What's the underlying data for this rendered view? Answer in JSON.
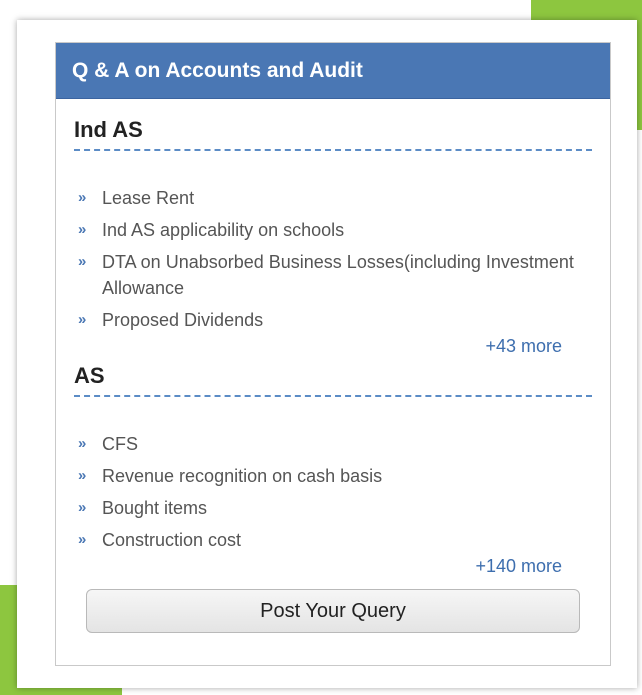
{
  "panel": {
    "title": "Q & A on Accounts and Audit",
    "button_label": "Post Your Query"
  },
  "sections": [
    {
      "heading": "Ind AS",
      "items": [
        "Lease Rent",
        "Ind AS applicability on schools",
        "DTA on Unabsorbed Business Losses(including Investment Allowance",
        "Proposed Dividends"
      ],
      "more_label": "+43 more"
    },
    {
      "heading": "AS",
      "items": [
        "CFS",
        "Revenue recognition on cash basis",
        "Bought items",
        "Construction cost"
      ],
      "more_label": "+140 more"
    }
  ],
  "bullet_glyph": "»",
  "colors": {
    "header_bg": "#4a77b4",
    "accent_green": "#8dc63f",
    "link": "#3d6eae"
  }
}
